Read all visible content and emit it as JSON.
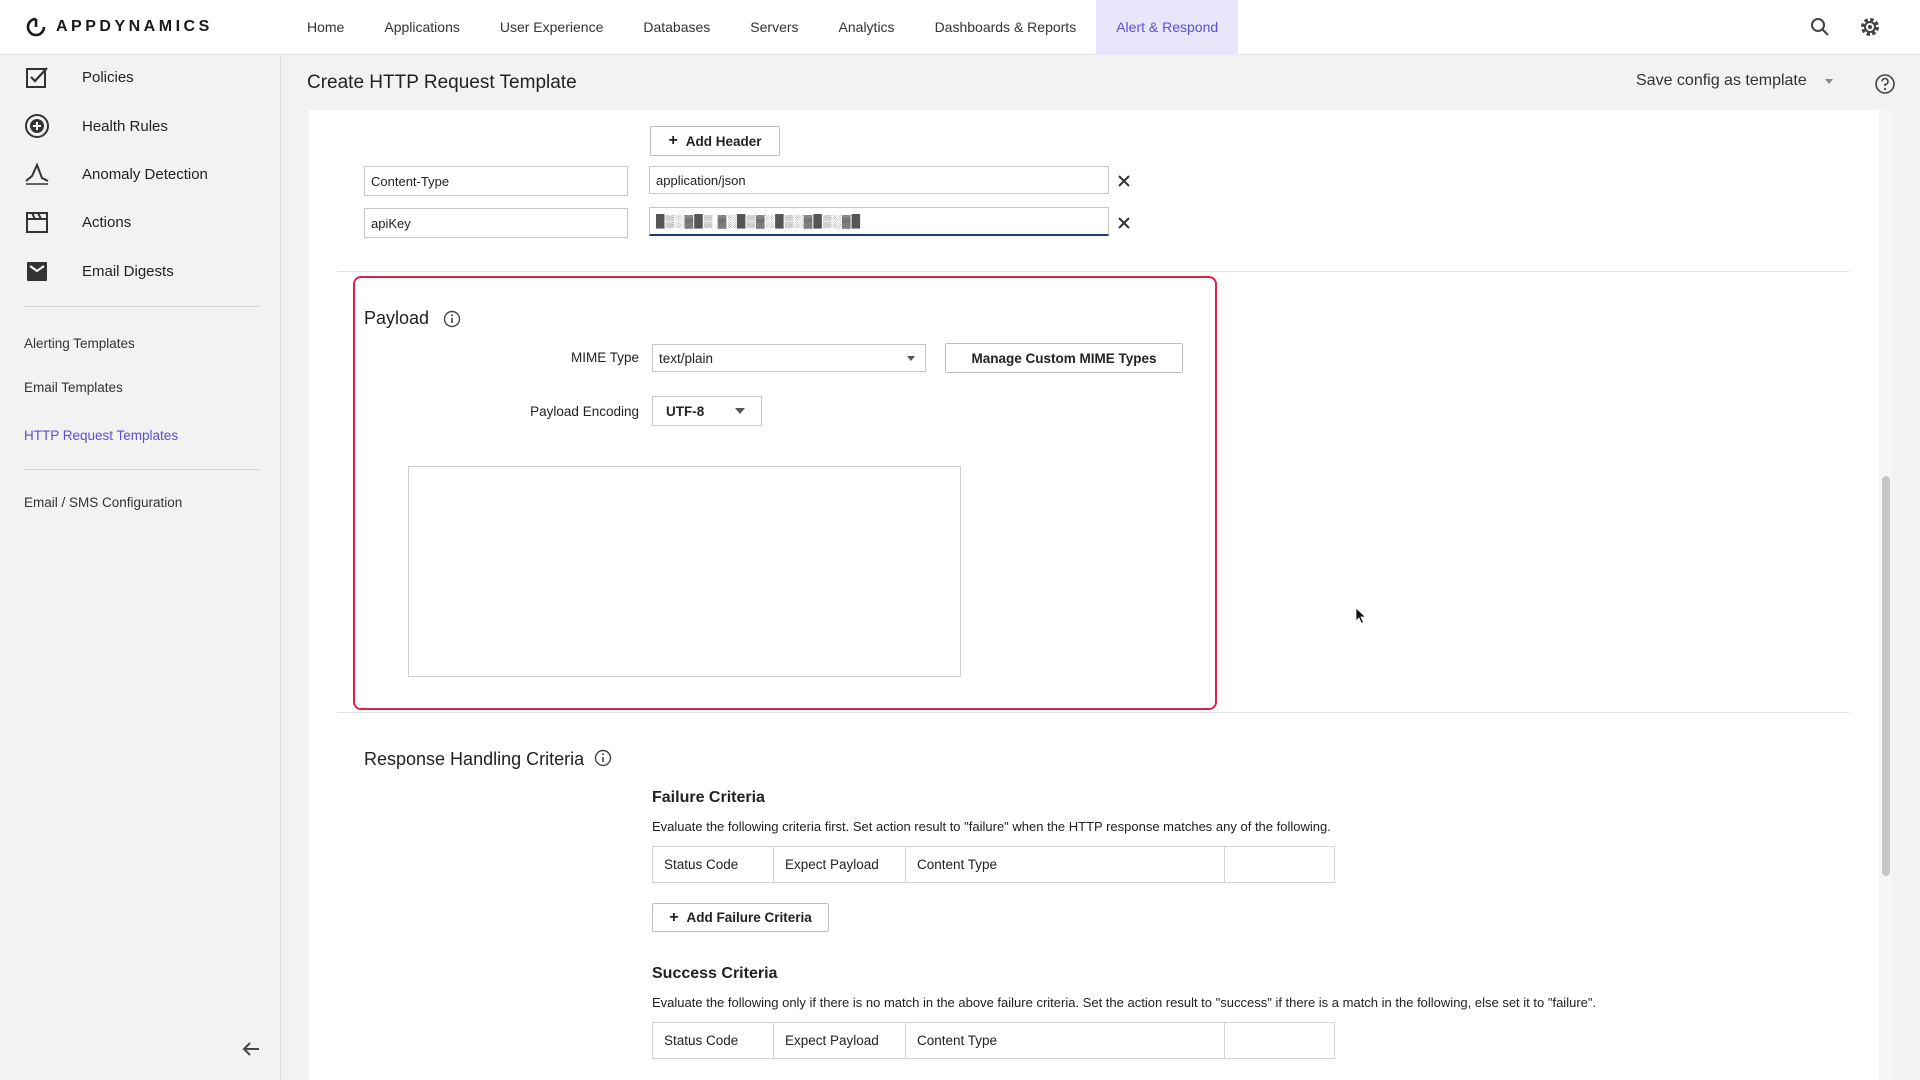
{
  "brand": {
    "name": "APPDYNAMICS"
  },
  "nav": {
    "items": [
      "Home",
      "Applications",
      "User Experience",
      "Databases",
      "Servers",
      "Analytics",
      "Dashboards & Reports",
      "Alert & Respond"
    ],
    "active": "Alert & Respond"
  },
  "sidebar": {
    "main_items": [
      "Policies",
      "Health Rules",
      "Anomaly Detection",
      "Actions",
      "Email Digests"
    ],
    "template_links": [
      "Alerting Templates",
      "Email Templates",
      "HTTP Request Templates"
    ],
    "active_link": "HTTP Request Templates",
    "config_link": "Email / SMS Configuration"
  },
  "header": {
    "title": "Create HTTP Request Template",
    "save_config": "Save config as template"
  },
  "headers_section": {
    "add_header_label": "Add Header",
    "rows": [
      {
        "name": "Content-Type",
        "value": "application/json"
      },
      {
        "name": "apiKey",
        "value": "█▒░▓█▒ ▓░█▒▓░█▒░▓█▒░▓█"
      }
    ]
  },
  "payload": {
    "title": "Payload",
    "mime_label": "MIME Type",
    "mime_value": "text/plain",
    "manage_mime_label": "Manage Custom MIME Types",
    "encoding_label": "Payload Encoding",
    "encoding_value": "UTF-8"
  },
  "response": {
    "title": "Response Handling Criteria",
    "failure": {
      "title": "Failure Criteria",
      "desc": "Evaluate the following criteria first. Set action result to \"failure\" when the HTTP response matches any of the following.",
      "columns": [
        "Status Code",
        "Expect Payload",
        "Content Type",
        ""
      ],
      "add_label": "Add Failure Criteria"
    },
    "success": {
      "title": "Success Criteria",
      "desc": "Evaluate the following only if there is no match in the above failure criteria. Set the action result to \"success\" if there is a match in the following, else set it to \"failure\".",
      "columns": [
        "Status Code",
        "Expect Payload",
        "Content Type",
        ""
      ]
    }
  },
  "colors": {
    "accent": "#5b4dd6",
    "highlight_border": "#e0224a",
    "active_nav_bg": "#e9e6fb"
  }
}
